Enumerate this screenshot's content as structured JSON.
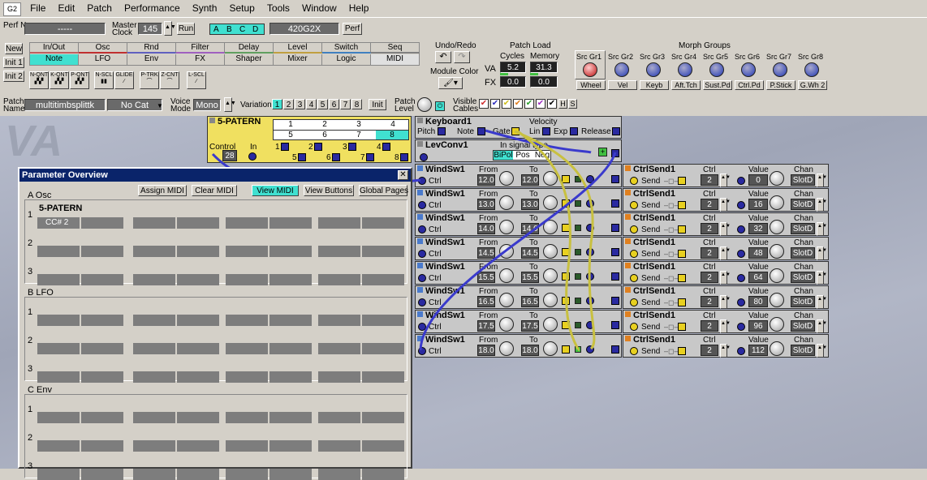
{
  "menubar": {
    "items": [
      "File",
      "Edit",
      "Patch",
      "Performance",
      "Synth",
      "Setup",
      "Tools",
      "Window",
      "Help"
    ]
  },
  "perf": {
    "perf_name_label": "Perf Name",
    "perf_name_value": "-----",
    "master_clock_label": "Master Clock",
    "master_clock_value": "145",
    "run_label": "Run",
    "slots": [
      "A",
      "B",
      "C",
      "D"
    ],
    "synth_name": "420G2X",
    "perf_button": "Perf"
  },
  "module_tabs": {
    "new": "New",
    "init1": "Init 1",
    "init2": "Init 2",
    "row1": [
      "In/Out",
      "Osc",
      "Rnd",
      "Filter",
      "Delay",
      "Level",
      "Switch",
      "Seq"
    ],
    "row2": [
      "Note",
      "LFO",
      "Env",
      "FX",
      "Shaper",
      "Mixer",
      "Logic",
      "MIDI"
    ],
    "icons": [
      "N-QNT",
      "K-QNT",
      "P-QNT",
      "N-SCL",
      "GLIDE",
      "P-TRK",
      "Z-CNT",
      "L-SCL"
    ]
  },
  "undo": {
    "label": "Undo/Redo",
    "module_color": "Module Color"
  },
  "patch_load": {
    "label": "Patch Load",
    "cycles": "Cycles",
    "memory": "Memory",
    "va": "VA",
    "fx": "FX",
    "va_cycles": "5.2",
    "va_memory": "31.3",
    "fx_cycles": "0.0",
    "fx_memory": "0.0"
  },
  "morph": {
    "label": "Morph Groups",
    "groups": [
      "Src Gr1",
      "Src Gr2",
      "Src Gr3",
      "Src Gr4",
      "Src Gr5",
      "Src Gr6",
      "Src Gr7",
      "Src Gr8"
    ],
    "sources": [
      "Wheel",
      "Vel",
      "Keyb",
      "Aft.Tch",
      "Sust.Pd",
      "Ctrl.Pd",
      "P.Stick",
      "G.Wh 2"
    ]
  },
  "patchbar": {
    "patch_name_label": "Patch Name",
    "patch_name": "multitimbsplittk",
    "category": "No Cat",
    "voice_mode_label": "Voice Mode",
    "voice_mode": "Mono",
    "variation_label": "Variation",
    "variations": [
      "1",
      "2",
      "3",
      "4",
      "5",
      "6",
      "7",
      "8"
    ],
    "init": "Init",
    "patch_level_label": "Patch Level",
    "visible_cables_label": "Visible Cables",
    "h": "H",
    "s": "S"
  },
  "va_watermark": "VA",
  "patern": {
    "title": "5-PATERN",
    "row1": [
      "1",
      "2",
      "3",
      "4"
    ],
    "row2": [
      "5",
      "6",
      "7",
      "8"
    ],
    "control_label": "Control",
    "control_value": "28",
    "in_label": "In",
    "jack_labels": [
      "1",
      "2",
      "3",
      "4",
      "5",
      "6",
      "7",
      "8"
    ]
  },
  "keyboard": {
    "title": "Keyboard1",
    "pitch": "Pitch",
    "note": "Note",
    "gate": "Gate",
    "velocity": "Velocity",
    "lin": "Lin",
    "exp": "Exp",
    "release": "Release"
  },
  "levconv": {
    "title": "LevConv1",
    "signal_type": "In signal type",
    "options": [
      "BiPol",
      "Pos",
      "Neg"
    ]
  },
  "windsw": {
    "title": "WindSw1",
    "ctrl": "Ctrl",
    "from": "From",
    "to": "To",
    "rows": [
      {
        "from": "12.0",
        "to": "12.0"
      },
      {
        "from": "13.0",
        "to": "13.0"
      },
      {
        "from": "14.0",
        "to": "14.0"
      },
      {
        "from": "14.5",
        "to": "14.5"
      },
      {
        "from": "15.5",
        "to": "15.5"
      },
      {
        "from": "16.5",
        "to": "16.5"
      },
      {
        "from": "17.5",
        "to": "17.5"
      },
      {
        "from": "18.0",
        "to": "18.0"
      }
    ]
  },
  "ctrlsend": {
    "title": "CtrlSend1",
    "send": "Send",
    "ctrl_label": "Ctrl",
    "value_label": "Value",
    "chan_label": "Chan",
    "rows": [
      {
        "ctrl": "2",
        "value": "0",
        "chan": "SlotD"
      },
      {
        "ctrl": "2",
        "value": "16",
        "chan": "SlotD"
      },
      {
        "ctrl": "2",
        "value": "32",
        "chan": "SlotD"
      },
      {
        "ctrl": "2",
        "value": "48",
        "chan": "SlotD"
      },
      {
        "ctrl": "2",
        "value": "64",
        "chan": "SlotD"
      },
      {
        "ctrl": "2",
        "value": "80",
        "chan": "SlotD"
      },
      {
        "ctrl": "2",
        "value": "96",
        "chan": "SlotD"
      },
      {
        "ctrl": "2",
        "value": "112",
        "chan": "SlotD"
      }
    ]
  },
  "param_overview": {
    "title": "Parameter Overview",
    "buttons": [
      "Assign MIDI",
      "Clear MIDI",
      "View MIDI",
      "View Buttons",
      "Global Pages"
    ],
    "sections": [
      {
        "label": "A  Osc",
        "module": "5-PATERN",
        "first_cell": "CC# 2"
      },
      {
        "label": "B  LFO"
      },
      {
        "label": "C  Env"
      }
    ],
    "row_numbers": [
      "1",
      "2",
      "3"
    ]
  },
  "colors": {
    "yellow_module": "#f0e060",
    "tab_cyan": "#40e0d0",
    "cable_blue": "#3030c0",
    "cable_yellow": "#c8c040"
  }
}
